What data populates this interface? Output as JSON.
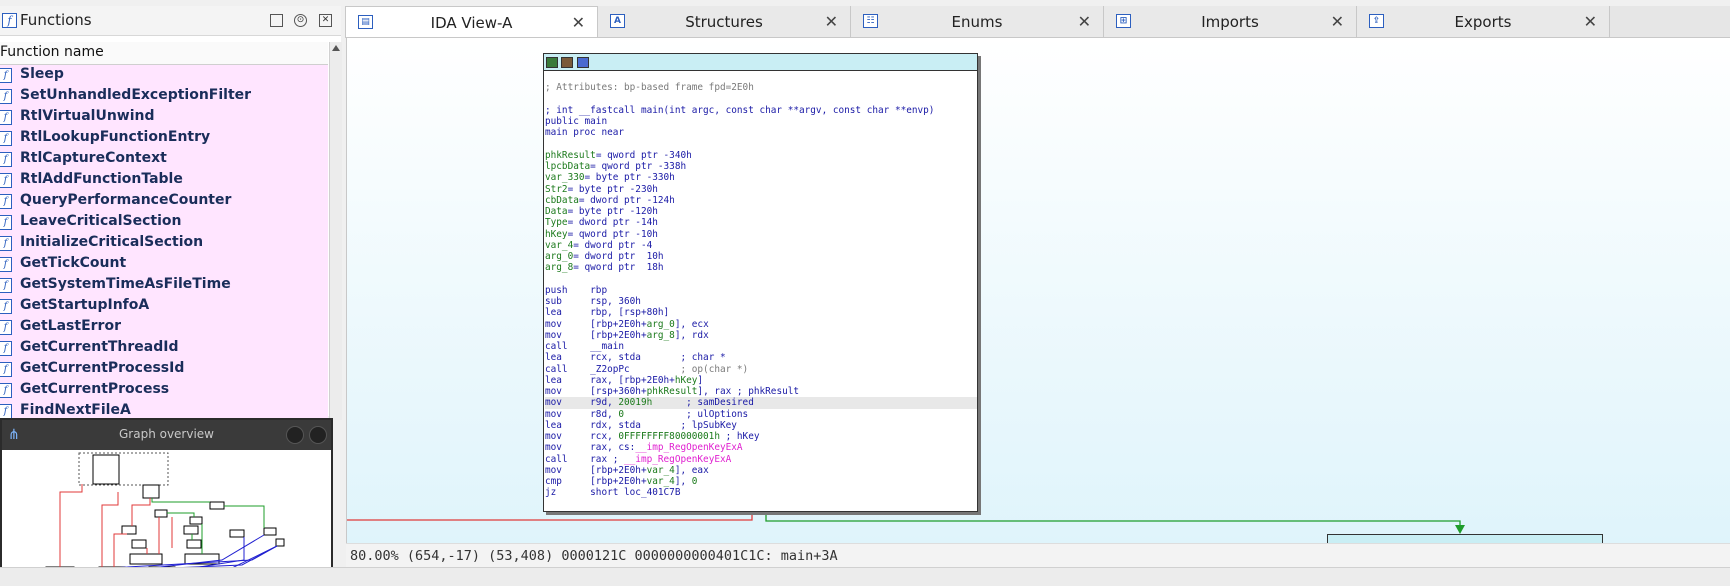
{
  "functions_panel": {
    "title": "Functions",
    "column_header": "Function name",
    "items": [
      "Sleep",
      "SetUnhandledExceptionFilter",
      "RtlVirtualUnwind",
      "RtlLookupFunctionEntry",
      "RtlCaptureContext",
      "RtlAddFunctionTable",
      "QueryPerformanceCounter",
      "LeaveCriticalSection",
      "InitializeCriticalSection",
      "GetTickCount",
      "GetSystemTimeAsFileTime",
      "GetStartupInfoA",
      "GetLastError",
      "GetCurrentThreadId",
      "GetCurrentProcessId",
      "GetCurrentProcess",
      "FindNextFileA"
    ]
  },
  "graph_overview": {
    "title": "Graph overview"
  },
  "tabs": [
    {
      "label": "IDA View-A",
      "icon": "ida-view-icon",
      "active": true
    },
    {
      "label": "Structures",
      "icon": "structures-icon",
      "active": false
    },
    {
      "label": "Enums",
      "icon": "enums-icon",
      "active": false
    },
    {
      "label": "Imports",
      "icon": "imports-icon",
      "active": false
    },
    {
      "label": "Exports",
      "icon": "exports-icon",
      "active": false
    }
  ],
  "code": [
    {
      "p": [
        {
          "t": "",
          "c": "k"
        }
      ]
    },
    {
      "p": [
        {
          "t": "; Attributes: bp-based frame fpd=2E0h",
          "c": "g"
        }
      ]
    },
    {
      "p": [
        {
          "t": "",
          "c": "k"
        }
      ]
    },
    {
      "p": [
        {
          "t": "; int __fastcall main(int argc, const char **argv, const char **envp)",
          "c": "b"
        }
      ]
    },
    {
      "p": [
        {
          "t": "public main",
          "c": "b"
        }
      ]
    },
    {
      "p": [
        {
          "t": "main proc near",
          "c": "b"
        }
      ]
    },
    {
      "p": [
        {
          "t": "",
          "c": "k"
        }
      ]
    },
    {
      "p": [
        {
          "t": "phkResult",
          "c": "gr"
        },
        {
          "t": "= qword ptr -340h",
          "c": "b"
        }
      ]
    },
    {
      "p": [
        {
          "t": "lpcbData",
          "c": "gr"
        },
        {
          "t": "= qword ptr -338h",
          "c": "b"
        }
      ]
    },
    {
      "p": [
        {
          "t": "var_330",
          "c": "gr"
        },
        {
          "t": "= byte ptr -330h",
          "c": "b"
        }
      ]
    },
    {
      "p": [
        {
          "t": "Str2",
          "c": "gr"
        },
        {
          "t": "= byte ptr -230h",
          "c": "b"
        }
      ]
    },
    {
      "p": [
        {
          "t": "cbData",
          "c": "gr"
        },
        {
          "t": "= dword ptr -124h",
          "c": "b"
        }
      ]
    },
    {
      "p": [
        {
          "t": "Data",
          "c": "gr"
        },
        {
          "t": "= byte ptr -120h",
          "c": "b"
        }
      ]
    },
    {
      "p": [
        {
          "t": "Type",
          "c": "gr"
        },
        {
          "t": "= dword ptr -14h",
          "c": "b"
        }
      ]
    },
    {
      "p": [
        {
          "t": "hKey",
          "c": "gr"
        },
        {
          "t": "= qword ptr -10h",
          "c": "b"
        }
      ]
    },
    {
      "p": [
        {
          "t": "var_4",
          "c": "gr"
        },
        {
          "t": "= dword ptr -4",
          "c": "b"
        }
      ]
    },
    {
      "p": [
        {
          "t": "arg_0",
          "c": "gr"
        },
        {
          "t": "= dword ptr  10h",
          "c": "b"
        }
      ]
    },
    {
      "p": [
        {
          "t": "arg_8",
          "c": "gr"
        },
        {
          "t": "= qword ptr  18h",
          "c": "b"
        }
      ]
    },
    {
      "p": [
        {
          "t": "",
          "c": "k"
        }
      ]
    },
    {
      "p": [
        {
          "t": "push    rbp",
          "c": "b"
        }
      ]
    },
    {
      "p": [
        {
          "t": "sub     rsp, 360h",
          "c": "b"
        }
      ]
    },
    {
      "p": [
        {
          "t": "lea     rbp, [rsp+80h]",
          "c": "b"
        }
      ]
    },
    {
      "p": [
        {
          "t": "mov     [rbp+2E0h+",
          "c": "b"
        },
        {
          "t": "arg_0",
          "c": "gr"
        },
        {
          "t": "], ecx",
          "c": "b"
        }
      ]
    },
    {
      "p": [
        {
          "t": "mov     [rbp+2E0h+",
          "c": "b"
        },
        {
          "t": "arg_8",
          "c": "gr"
        },
        {
          "t": "], rdx",
          "c": "b"
        }
      ]
    },
    {
      "p": [
        {
          "t": "call    __main",
          "c": "b"
        }
      ]
    },
    {
      "p": [
        {
          "t": "lea     rcx, stda       ",
          "c": "b"
        },
        {
          "t": "; char *",
          "c": "b"
        }
      ]
    },
    {
      "p": [
        {
          "t": "call    _Z2opPc         ",
          "c": "b"
        },
        {
          "t": "; op(char *)",
          "c": "g"
        }
      ]
    },
    {
      "p": [
        {
          "t": "lea     rax, [rbp+2E0h+",
          "c": "b"
        },
        {
          "t": "hKey",
          "c": "gr"
        },
        {
          "t": "]",
          "c": "b"
        }
      ]
    },
    {
      "p": [
        {
          "t": "mov     [rsp+360h+",
          "c": "b"
        },
        {
          "t": "phkResult",
          "c": "gr"
        },
        {
          "t": "], rax ; phkResult",
          "c": "b"
        }
      ]
    },
    {
      "hl": true,
      "p": [
        {
          "t": "mov     r9d, ",
          "c": "b"
        },
        {
          "t": "20019h",
          "c": "gr"
        },
        {
          "t": "      ; samDesired",
          "c": "b"
        }
      ]
    },
    {
      "p": [
        {
          "t": "mov     r8d, ",
          "c": "b"
        },
        {
          "t": "0",
          "c": "gr"
        },
        {
          "t": "           ; ulOptions",
          "c": "b"
        }
      ]
    },
    {
      "p": [
        {
          "t": "lea     rdx, stda       ; lpSubKey",
          "c": "b"
        }
      ]
    },
    {
      "p": [
        {
          "t": "mov     rcx, ",
          "c": "b"
        },
        {
          "t": "0FFFFFFFF80000001h",
          "c": "gr"
        },
        {
          "t": " ; hKey",
          "c": "b"
        }
      ]
    },
    {
      "p": [
        {
          "t": "mov     rax, cs:",
          "c": "b"
        },
        {
          "t": "__imp_RegOpenKeyExA",
          "c": "m"
        }
      ]
    },
    {
      "p": [
        {
          "t": "call    rax ; ",
          "c": "b"
        },
        {
          "t": "__imp_RegOpenKeyExA",
          "c": "m"
        }
      ]
    },
    {
      "p": [
        {
          "t": "mov     [rbp+2E0h+",
          "c": "b"
        },
        {
          "t": "var_4",
          "c": "gr"
        },
        {
          "t": "], eax",
          "c": "b"
        }
      ]
    },
    {
      "p": [
        {
          "t": "cmp     [rbp+2E0h+",
          "c": "b"
        },
        {
          "t": "var_4",
          "c": "gr"
        },
        {
          "t": "], ",
          "c": "b"
        },
        {
          "t": "0",
          "c": "gr"
        }
      ]
    },
    {
      "p": [
        {
          "t": "jz      short loc_401C7B",
          "c": "b"
        }
      ]
    }
  ],
  "status_line": "80.00% (654,-17) (53,408) 0000121C 0000000000401C1C: main+3A",
  "colors": {
    "b": "#1a1aa6",
    "g": "#7a7a7a",
    "gr": "#1c7a1c",
    "m": "#e020d0",
    "k": "#000000",
    "edge_red": "#e03a3a",
    "edge_green": "#1e9c2a",
    "edge_blue": "#2020d0"
  }
}
